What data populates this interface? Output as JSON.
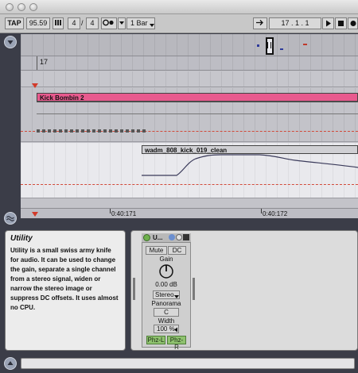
{
  "transport": {
    "tap": "TAP",
    "tempo": "95.59",
    "meter_num": "4",
    "meter_den": "4",
    "quantize": "1 Bar",
    "position": "17 .  1 .  1"
  },
  "ruler": {
    "bar_label": "17",
    "time_labels": [
      "0:40:171",
      "0:40:172"
    ]
  },
  "clips": {
    "kick_clip": "Kick Bombin 2",
    "audio_clip": "wadm_808_kick_019_clean"
  },
  "info_view": {
    "title": "Utility",
    "text": "Utility is a small swiss army knife for audio. It can be used to change the gain, separate a single channel from a stereo signal, widen or narrow the stereo image or suppress DC offsets. It uses almost no CPU."
  },
  "device": {
    "title": "U...",
    "mute": "Mute",
    "dc": "DC",
    "gain_label": "Gain",
    "gain_value": "0.00 dB",
    "mode": "Stereo",
    "panorama_label": "Panorama",
    "panorama_value": "C",
    "width_label": "Width",
    "width_value": "100 %",
    "phz_l": "Phz-L",
    "phz_r": "Phz-R"
  },
  "colors": {
    "kick_clip": "#e85a8e",
    "audio_clip": "#cfcfcf",
    "device_power": "#6fb14d"
  }
}
